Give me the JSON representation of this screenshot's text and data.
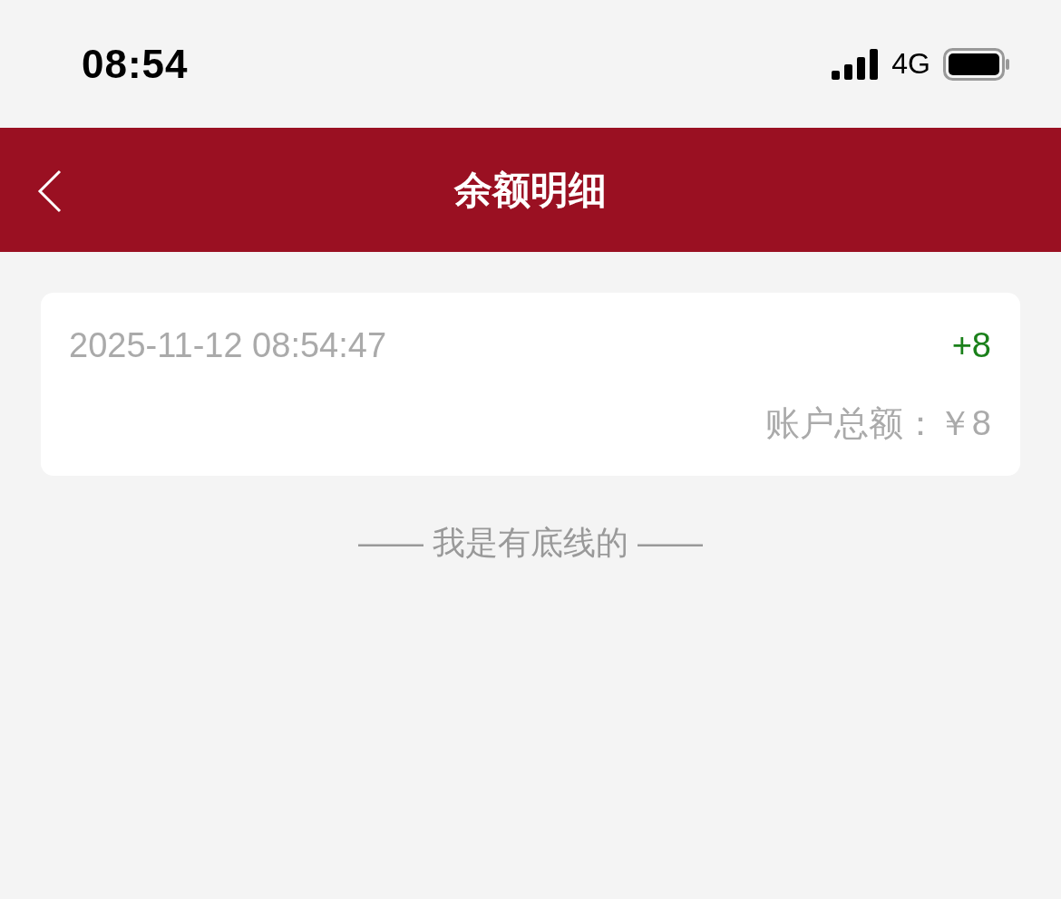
{
  "status_bar": {
    "time": "08:54",
    "network": "4G"
  },
  "header": {
    "title": "余额明细"
  },
  "records": [
    {
      "time": "2025-11-12 08:54:47",
      "amount": "+8",
      "kind": "income",
      "balance": "账户总额：￥8"
    }
  ],
  "footer": "—— 我是有底线的 ——"
}
